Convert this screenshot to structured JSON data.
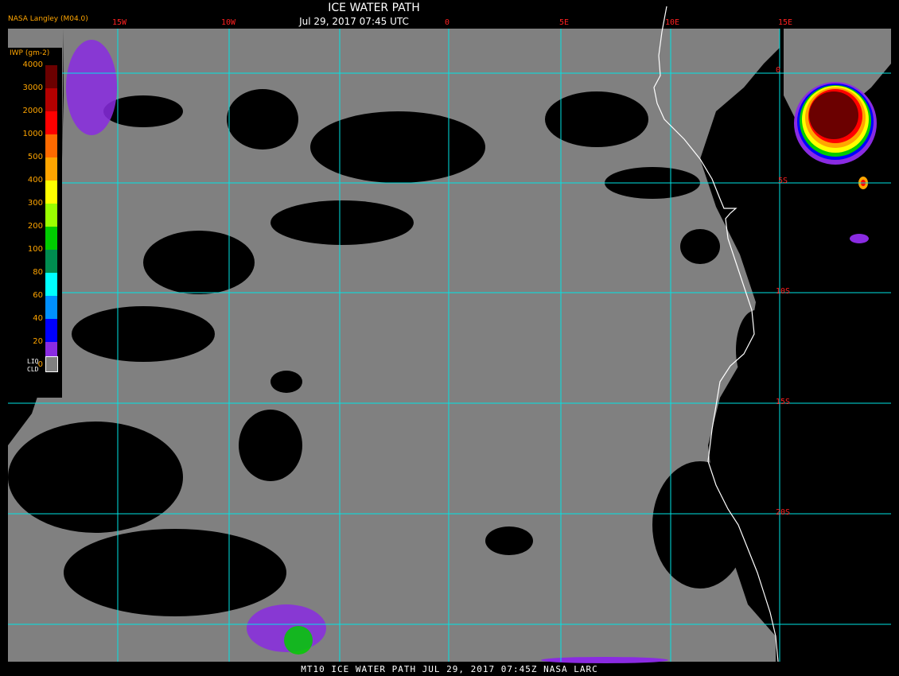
{
  "header": {
    "title": "ICE WATER PATH",
    "datetime": "Jul 29, 2017 07:45 UTC",
    "producer": "NASA Langley (M04.0)"
  },
  "legend": {
    "title": "IWP (gm-2)",
    "ticks": [
      "4000",
      "3000",
      "2000",
      "1000",
      "500",
      "400",
      "300",
      "200",
      "100",
      "80",
      "60",
      "40",
      "20",
      "0"
    ],
    "colors": [
      "#6b0000",
      "#b30000",
      "#ff0000",
      "#ff6a00",
      "#ffa500",
      "#ffff00",
      "#9aff00",
      "#00cc00",
      "#008c50",
      "#00ffff",
      "#0090ff",
      "#0000ff",
      "#8a2be2"
    ],
    "liquid_cloud_label": "LIQ\nCLD",
    "liquid_cloud_color": "#808080"
  },
  "map": {
    "longitude_labels": [
      "15W",
      "10W",
      "0",
      "5E",
      "10E",
      "15E"
    ],
    "latitude_labels": [
      "0",
      "5S",
      "10S",
      "15S",
      "20S"
    ],
    "grid_color": "#00e5e5",
    "coastline_color": "#ffffff",
    "background_color": "#000000",
    "cloud_color": "#808080"
  },
  "footer": {
    "text": "MT10  ICE WATER PATH  JUL 29, 2017 07:45Z  NASA LARC"
  }
}
